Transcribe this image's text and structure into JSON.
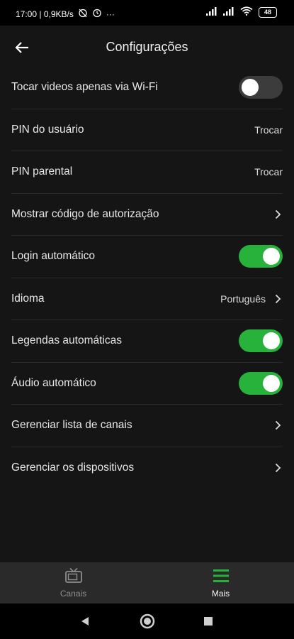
{
  "status_bar": {
    "time_speed": "17:00 | 0,9KB/s",
    "dots": "···",
    "battery": "48"
  },
  "header": {
    "title": "Configurações",
    "back_icon": "arrow-left-icon"
  },
  "settings": [
    {
      "label": "Tocar videos apenas via Wi-Fi",
      "type": "toggle",
      "enabled": false
    },
    {
      "label": "PIN do usuário",
      "type": "action",
      "value": "Trocar"
    },
    {
      "label": "PIN parental",
      "type": "action",
      "value": "Trocar"
    },
    {
      "label": "Mostrar código de autorização",
      "type": "chevron"
    },
    {
      "label": "Login automático",
      "type": "toggle",
      "enabled": true
    },
    {
      "label": "Idioma",
      "type": "chevron",
      "value": "Português"
    },
    {
      "label": "Legendas automáticas",
      "type": "toggle",
      "enabled": true
    },
    {
      "label": "Áudio automático",
      "type": "toggle",
      "enabled": true
    },
    {
      "label": "Gerenciar lista de canais",
      "type": "chevron"
    },
    {
      "label": "Gerenciar os dispositivos",
      "type": "chevron"
    }
  ],
  "bottom_nav": {
    "items": [
      {
        "label": "Canais",
        "icon": "tv-icon",
        "active": false
      },
      {
        "label": "Mais",
        "icon": "menu-icon",
        "active": true
      }
    ]
  },
  "colors": {
    "accent_green": "#27b23c",
    "background": "#151515",
    "nav_background": "#2a2a2a"
  }
}
